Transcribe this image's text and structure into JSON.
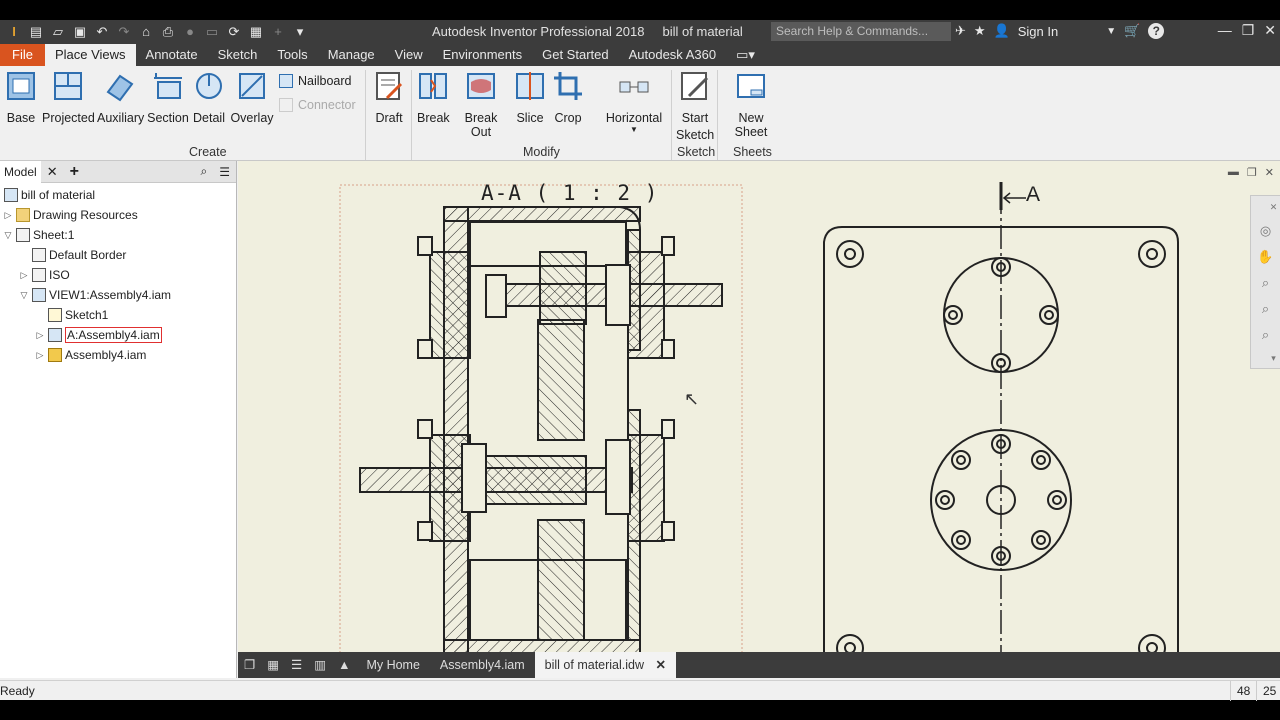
{
  "titlebar": {
    "app_title": "Autodesk Inventor Professional 2018",
    "document_title": "bill of material",
    "search_placeholder": "Search Help & Commands...",
    "sign_in": "Sign In"
  },
  "tabs": [
    "File",
    "Place Views",
    "Annotate",
    "Sketch",
    "Tools",
    "Manage",
    "View",
    "Environments",
    "Get Started",
    "Autodesk A360"
  ],
  "active_tab": "Place Views",
  "ribbon": {
    "create": {
      "label": "Create",
      "buttons": [
        "Base",
        "Projected",
        "Auxiliary",
        "Section",
        "Detail",
        "Overlay"
      ],
      "small": [
        "Nailboard",
        "Connector"
      ]
    },
    "draft": "Draft",
    "modify": {
      "label": "Modify",
      "buttons": [
        "Break",
        "Break Out",
        "Slice",
        "Crop"
      ],
      "horizontal": "Horizontal"
    },
    "sketch": {
      "label": "Sketch",
      "start_line1": "Start",
      "start_line2": "Sketch"
    },
    "sheets": {
      "label": "Sheets",
      "new_sheet": "New Sheet"
    }
  },
  "browser": {
    "tab": "Model",
    "tree": [
      {
        "label": "bill of material"
      },
      {
        "label": "Drawing Resources"
      },
      {
        "label": "Sheet:1"
      },
      {
        "label": "Default Border"
      },
      {
        "label": "ISO"
      },
      {
        "label": "VIEW1:Assembly4.iam"
      },
      {
        "label": "Sketch1"
      },
      {
        "label": "A:Assembly4.iam"
      },
      {
        "label": "Assembly4.iam"
      }
    ]
  },
  "canvas": {
    "section_title": "A-A ( 1 : 2 )",
    "section_marker": "A"
  },
  "doc_tabs": [
    "My Home",
    "Assembly4.iam",
    "bill of material.idw"
  ],
  "status": {
    "text": "Ready",
    "count1": "48",
    "count2": "25"
  },
  "colors": {
    "file_tab": "#d9541f",
    "canvas_bg": "#f0efdf",
    "selected_outline": "#e03030"
  }
}
